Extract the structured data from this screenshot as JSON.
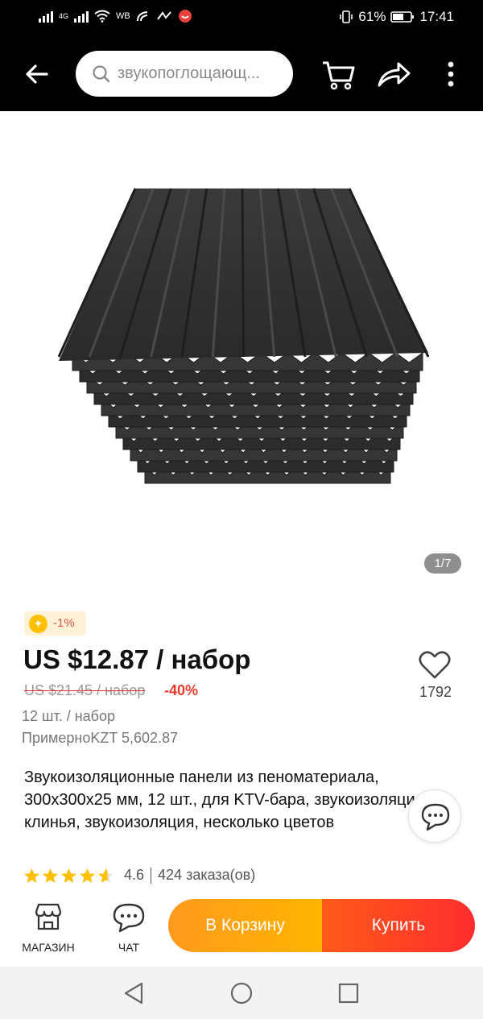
{
  "status_bar": {
    "network_a": "4G",
    "network_b": "4G",
    "carrier_tag": "WB",
    "battery": "61%",
    "time": "17:41"
  },
  "app_bar": {
    "search_placeholder": "звукопоглощающ...",
    "icons": [
      "back-arrow-icon",
      "search-icon",
      "cart-icon",
      "share-icon",
      "more-icon"
    ]
  },
  "gallery": {
    "counter": "1/7"
  },
  "product": {
    "coupon": "-1%",
    "price": "US $12.87 / набор",
    "old_price": "US $21.45 / набор",
    "discount": "-40%",
    "favorites": "1792",
    "pack_info": "12 шт. / набор",
    "approx_price": "ПримерноKZT 5,602.87",
    "title": "Звукоизоляционные панели из пеноматериала, 300x300x25 мм, 12 шт., для KTV-бара, звукоизоляция, клинья, звукоизоляция, несколько цветов",
    "rating_value": "4.6",
    "rating_stars": 4.6,
    "orders": "424 заказа(ов)"
  },
  "bottom_bar": {
    "store_label": "МАГАЗИН",
    "chat_label": "ЧАТ",
    "add_to_cart": "В Корзину",
    "buy": "Купить"
  },
  "colors": {
    "accent_orange": "#ffb400",
    "accent_red": "#ff2d2d",
    "discount_red": "#e83b30",
    "star_yellow": "#ffc000"
  }
}
